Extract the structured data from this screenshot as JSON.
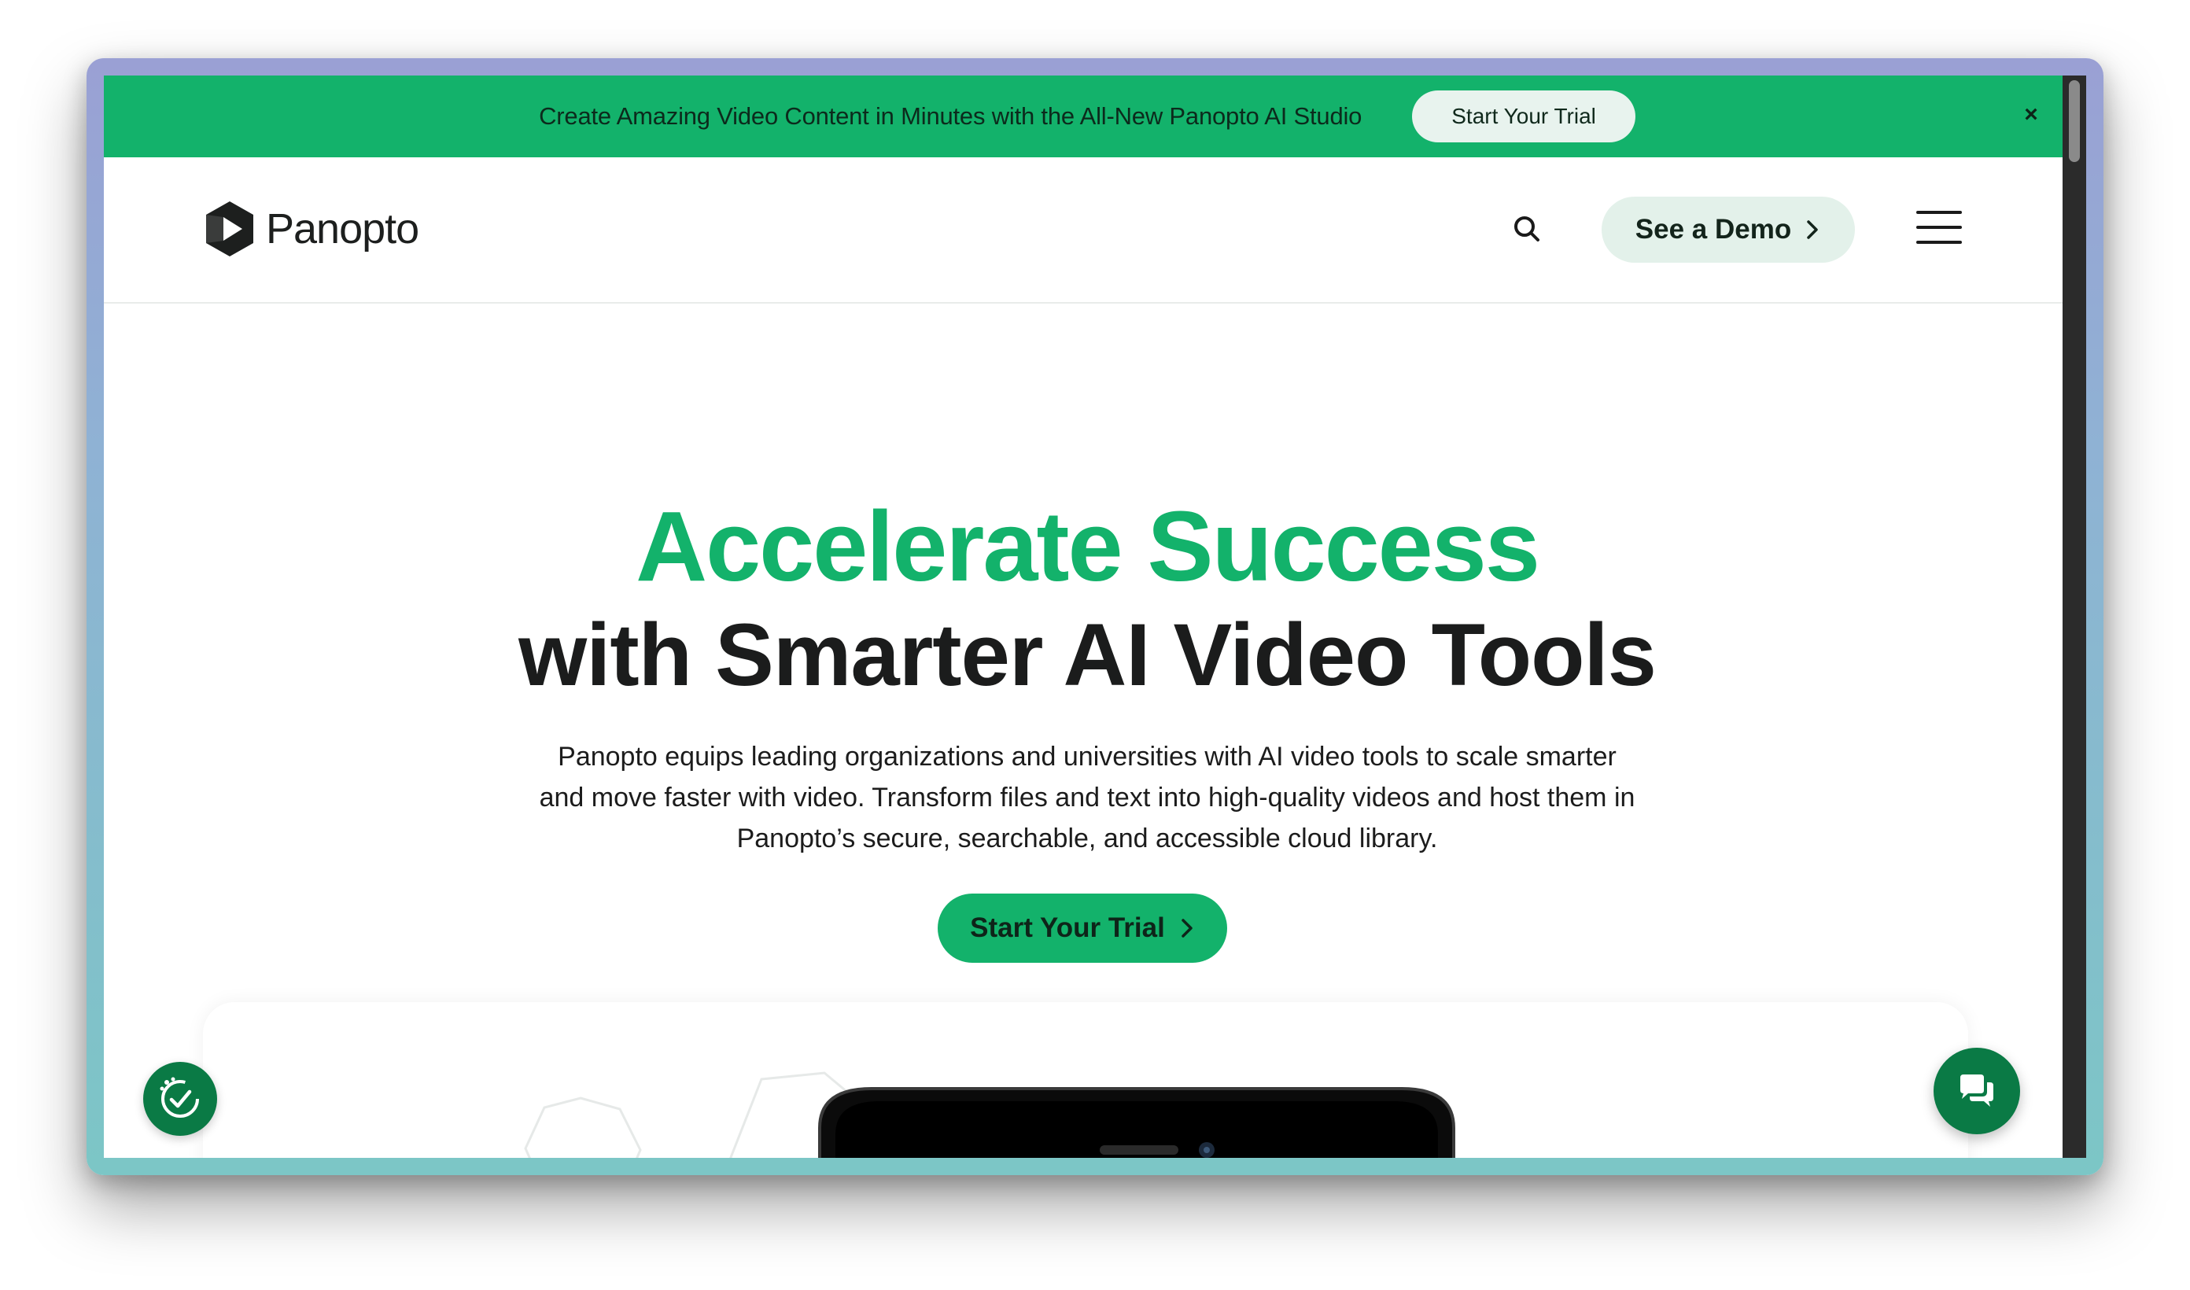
{
  "banner": {
    "text": "Create Amazing Video Content in Minutes with the All-New Panopto AI Studio",
    "button_label": "Start Your Trial",
    "close_label": "×"
  },
  "header": {
    "logo_text": "Panopto",
    "demo_label": "See a Demo"
  },
  "hero": {
    "title_line1": "Accelerate Success",
    "title_line2": "with Smarter AI Video Tools",
    "description": "Panopto equips leading organizations and universities with AI video tools to scale smarter and move faster with video. Transform files and text into high-quality videos and host them in Panopto’s secure, searchable, and accessible cloud library.",
    "cta_label": "Start Your Trial"
  },
  "colors": {
    "brand_green": "#13b26b",
    "dark_green": "#0a7a45",
    "demo_bg": "#e3f1ea"
  },
  "icons": {
    "search": "search-icon",
    "menu": "hamburger-menu-icon",
    "chevron": "chevron-right-icon",
    "close": "close-icon",
    "accessibility": "accessibility-icon",
    "chat": "chat-icon"
  }
}
